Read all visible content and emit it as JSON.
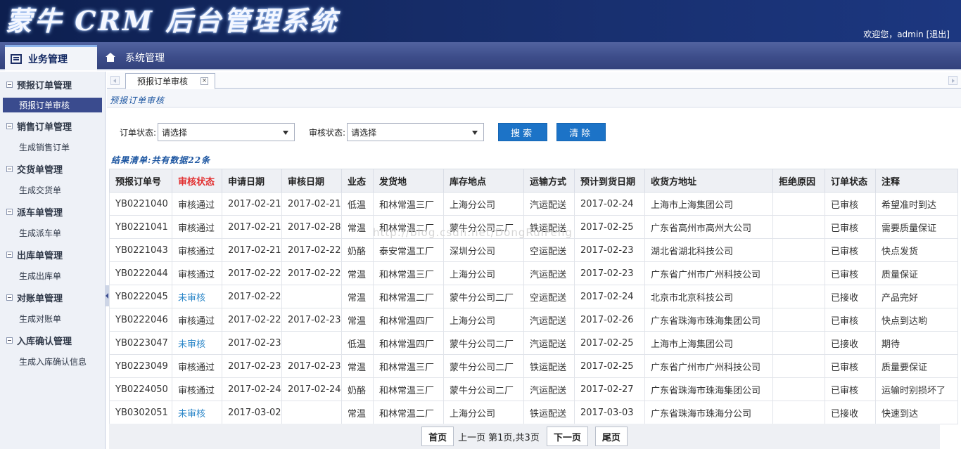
{
  "header": {
    "logo": "蒙牛 CRM 后台管理系统",
    "welcome": "欢迎您，admin",
    "logout": "[退出]"
  },
  "nav": {
    "active_tab": "业务管理",
    "tab2": "系统管理"
  },
  "sidebar": {
    "groups": [
      {
        "label": "预报订单管理",
        "item": "预报订单审核"
      },
      {
        "label": "销售订单管理",
        "item": "生成销售订单"
      },
      {
        "label": "交货单管理",
        "item": "生成交货单"
      },
      {
        "label": "派车单管理",
        "item": "生成派车单"
      },
      {
        "label": "出库单管理",
        "item": "生成出库单"
      },
      {
        "label": "对账单管理",
        "item": "生成对账单"
      },
      {
        "label": "入库确认管理",
        "item": "生成入库确认信息"
      }
    ]
  },
  "content_tab": {
    "label": "预报订单审核",
    "close": "×"
  },
  "panel_title": "预报订单审核",
  "filters": {
    "order_status_label": "订单状态:",
    "order_status_value": "请选择",
    "audit_status_label": "审核状态:",
    "audit_status_value": "请选择",
    "search_label": "搜索",
    "clear_label": "清除"
  },
  "result_title": "结果清单:共有数据22条",
  "table": {
    "headers": [
      "预报订单号",
      "审核状态",
      "申请日期",
      "审核日期",
      "业态",
      "发货地",
      "库存地点",
      "运输方式",
      "预计到货日期",
      "收货方地址",
      "拒绝原因",
      "订单状态",
      "注释"
    ],
    "rows": [
      [
        "YB0221040",
        "审核通过",
        "2017-02-21",
        "2017-02-21",
        "低温",
        "和林常温三厂",
        "上海分公司",
        "汽运配送",
        "2017-02-24",
        "上海市上海集团公司",
        "",
        "已审核",
        "希望准时到达"
      ],
      [
        "YB0221041",
        "审核通过",
        "2017-02-21",
        "2017-02-28",
        "常温",
        "和林常温二厂",
        "蒙牛分公司二厂",
        "铁运配送",
        "2017-02-25",
        "广东省高州市高州大公司",
        "",
        "已审核",
        "需要质量保证"
      ],
      [
        "YB0221043",
        "审核通过",
        "2017-02-21",
        "2017-02-22",
        "奶酪",
        "泰安常温工厂",
        "深圳分公司",
        "空运配送",
        "2017-02-23",
        "湖北省湖北科技公司",
        "",
        "已审核",
        "快点发货"
      ],
      [
        "YB0222044",
        "审核通过",
        "2017-02-22",
        "2017-02-22",
        "常温",
        "和林常温三厂",
        "上海分公司",
        "汽运配送",
        "2017-02-23",
        "广东省广州市广州科技公司",
        "",
        "已审核",
        "质量保证"
      ],
      [
        "YB0222045",
        "未审核",
        "2017-02-22",
        "",
        "常温",
        "和林常温二厂",
        "蒙牛分公司二厂",
        "空运配送",
        "2017-02-24",
        "北京市北京科技公司",
        "",
        "已接收",
        "产品完好"
      ],
      [
        "YB0222046",
        "审核通过",
        "2017-02-22",
        "2017-02-23",
        "常温",
        "和林常温四厂",
        "上海分公司",
        "汽运配送",
        "2017-02-26",
        "广东省珠海市珠海集团公司",
        "",
        "已审核",
        "快点到达哟"
      ],
      [
        "YB0223047",
        "未审核",
        "2017-02-23",
        "",
        "低温",
        "和林常温四厂",
        "蒙牛分公司二厂",
        "汽运配送",
        "2017-02-25",
        "上海市上海集团公司",
        "",
        "已接收",
        "期待"
      ],
      [
        "YB0223049",
        "审核通过",
        "2017-02-23",
        "2017-02-23",
        "常温",
        "和林常温三厂",
        "蒙牛分公司二厂",
        "铁运配送",
        "2017-02-25",
        "广东省广州市广州科技公司",
        "",
        "已审核",
        "质量要保证"
      ],
      [
        "YB0224050",
        "审核通过",
        "2017-02-24",
        "2017-02-24",
        "奶酪",
        "和林常温三厂",
        "蒙牛分公司二厂",
        "汽运配送",
        "2017-02-27",
        "广东省珠海市珠海集团公司",
        "",
        "已审核",
        "运输时别损坏了"
      ],
      [
        "YB0302051",
        "未审核",
        "2017-03-02",
        "",
        "常温",
        "和林常温二厂",
        "上海分公司",
        "铁运配送",
        "2017-03-03",
        "广东省珠海市珠海分公司",
        "",
        "已接收",
        "快速到达"
      ]
    ]
  },
  "watermark": "http://blog.csdn.net/DongRuiFeng",
  "pager": {
    "first": "首页",
    "prev": "上一页",
    "page_info": "第1页,共3页",
    "next": "下一页",
    "last": "尾页"
  },
  "colors": {
    "header_bg": "#162c68",
    "nav_bg": "#3d4d8a",
    "button_blue": "#1c73c7",
    "audit_header_red": "#e23030",
    "pending_blue": "#2a86c8"
  }
}
